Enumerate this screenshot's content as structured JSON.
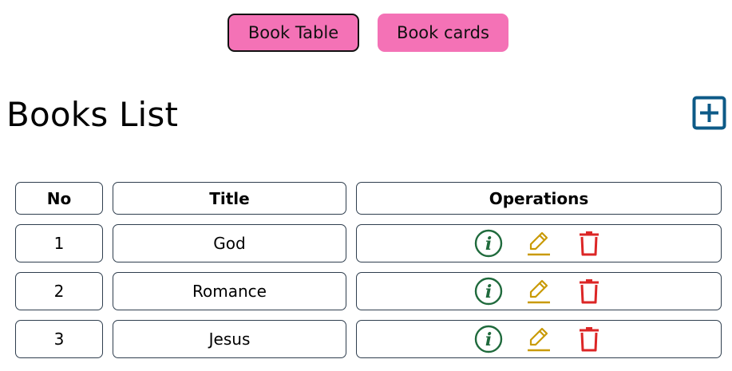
{
  "toggle": {
    "table_label": "Book Table",
    "cards_label": "Book cards",
    "active": "table",
    "button_color": "#f472b6"
  },
  "heading": "Books List",
  "add_icon": {
    "name": "plus-square-icon",
    "color": "#0d5a87"
  },
  "table": {
    "headers": {
      "no": "No",
      "title": "Title",
      "operations": "Operations"
    },
    "rows": [
      {
        "no": "1",
        "title": "God"
      },
      {
        "no": "2",
        "title": "Romance"
      },
      {
        "no": "3",
        "title": "Jesus"
      }
    ]
  },
  "operation_icons": [
    {
      "name": "info-circle-icon",
      "color": "#1f6a3c"
    },
    {
      "name": "edit-pencil-icon",
      "color": "#c99a06"
    },
    {
      "name": "trash-icon",
      "color": "#dc2626"
    }
  ]
}
